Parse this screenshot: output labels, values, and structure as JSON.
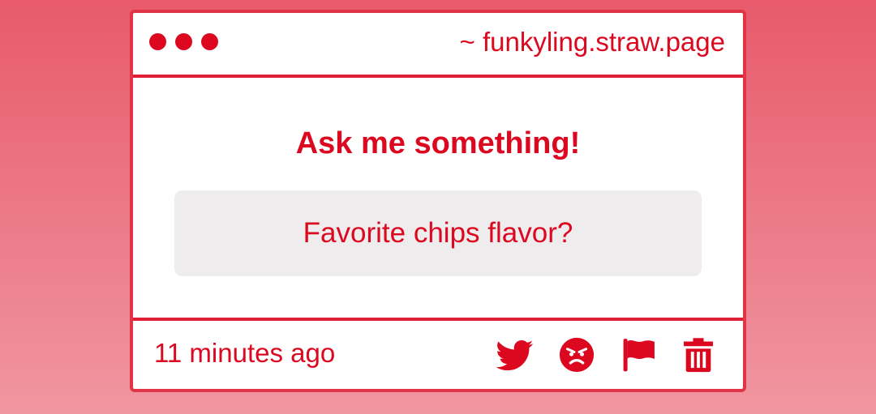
{
  "window": {
    "url": "~ funkyling.straw.page"
  },
  "main": {
    "prompt": "Ask me something!",
    "question": "Favorite chips flavor?"
  },
  "footer": {
    "timestamp": "11 minutes ago",
    "actions": [
      {
        "icon": "twitter-icon"
      },
      {
        "icon": "angry-face-icon"
      },
      {
        "icon": "flag-icon"
      },
      {
        "icon": "trash-icon"
      }
    ]
  },
  "colors": {
    "accent": "#dc0820",
    "background_top": "#e85a6c",
    "background_bottom": "#f096a0",
    "question_box": "#eeeced"
  }
}
